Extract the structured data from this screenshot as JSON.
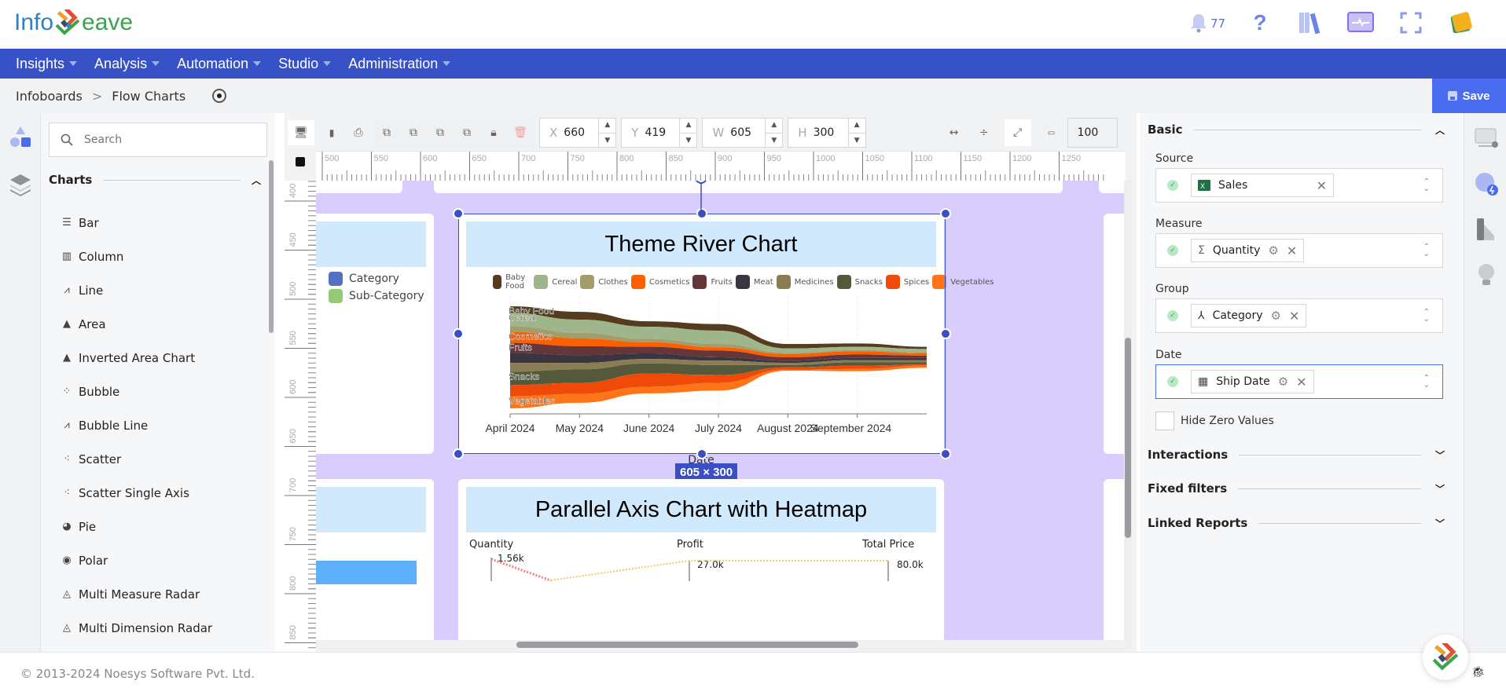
{
  "app": {
    "logo_left": "Info",
    "logo_right": "eave",
    "notification_count": "77"
  },
  "nav": {
    "items": [
      {
        "label": "Insights"
      },
      {
        "label": "Analysis"
      },
      {
        "label": "Automation"
      },
      {
        "label": "Studio"
      },
      {
        "label": "Administration"
      }
    ]
  },
  "breadcrumb": {
    "items": [
      "Infoboards",
      "Flow Charts"
    ],
    "separator": ">"
  },
  "save_label": "Save",
  "left_panel": {
    "search_placeholder": "Search",
    "section_title": "Charts",
    "items": [
      {
        "label": "Bar",
        "icon": "bar-chart-icon",
        "glyph": "☰"
      },
      {
        "label": "Column",
        "icon": "column-chart-icon",
        "glyph": "▥"
      },
      {
        "label": "Line",
        "icon": "line-chart-icon",
        "glyph": "⩘"
      },
      {
        "label": "Area",
        "icon": "area-chart-icon",
        "glyph": "▲"
      },
      {
        "label": "Inverted Area Chart",
        "icon": "inverted-area-chart-icon",
        "glyph": "▲"
      },
      {
        "label": "Bubble",
        "icon": "bubble-chart-icon",
        "glyph": "⁘"
      },
      {
        "label": "Bubble Line",
        "icon": "bubble-line-chart-icon",
        "glyph": "⩘"
      },
      {
        "label": "Scatter",
        "icon": "scatter-chart-icon",
        "glyph": "⁖"
      },
      {
        "label": "Scatter Single Axis",
        "icon": "scatter-single-axis-icon",
        "glyph": "⁖"
      },
      {
        "label": "Pie",
        "icon": "pie-chart-icon",
        "glyph": "◕"
      },
      {
        "label": "Polar",
        "icon": "polar-chart-icon",
        "glyph": "◉"
      },
      {
        "label": "Multi Measure Radar",
        "icon": "radar-chart-icon",
        "glyph": "◬"
      },
      {
        "label": "Multi Dimension Radar",
        "icon": "radar-chart-icon",
        "glyph": "◬"
      }
    ]
  },
  "toolbar": {
    "x_label": "X",
    "x_value": "660",
    "y_label": "Y",
    "y_value": "419",
    "w_label": "W",
    "w_value": "605",
    "h_label": "H",
    "h_value": "300",
    "zoom_value": "100"
  },
  "rulers": {
    "h_ticks": [
      "500",
      "550",
      "600",
      "650",
      "700",
      "750",
      "800",
      "850",
      "900",
      "950",
      "1000",
      "1050",
      "1100",
      "1150",
      "1200",
      "1250"
    ],
    "v_ticks": [
      "400",
      "450",
      "500",
      "550",
      "600",
      "650",
      "700",
      "750",
      "800",
      "850"
    ]
  },
  "canvas": {
    "left_card_legend": [
      {
        "label": "Category",
        "color": "#5470c6"
      },
      {
        "label": "Sub-Category",
        "color": "#91cc75"
      }
    ],
    "selection_size": "605 × 300",
    "bottom_card_title": "Parallel Axis Chart with Heatmap",
    "parallel_axes": [
      {
        "name": "Quantity",
        "max_label": "1.56k"
      },
      {
        "name": "Profit",
        "max_label": "27.0k"
      },
      {
        "name": "Total Price",
        "max_label": "80.0k"
      }
    ]
  },
  "chart_data": {
    "type": "area",
    "subtype": "theme-river",
    "title": "Theme River Chart",
    "xlabel": "Date",
    "ylabel": "",
    "x_ticks": [
      "April 2024",
      "May 2024",
      "June 2024",
      "July 2024",
      "August 2024",
      "September 2024"
    ],
    "x": [
      "2024-04",
      "2024-05",
      "2024-06",
      "2024-07",
      "2024-08",
      "2024-09",
      "2024-10"
    ],
    "legend_position": "top",
    "series_labels_shown": [
      "Baby Food",
      "Cereal",
      "Cosmetics",
      "Fruits",
      "Snacks",
      "Vegetables"
    ],
    "series": [
      {
        "name": "Baby Food",
        "color": "#553c1e",
        "values": [
          6,
          7,
          5,
          6,
          4,
          3,
          2
        ]
      },
      {
        "name": "Cereal",
        "color": "#9fb58c",
        "values": [
          12,
          12,
          11,
          12,
          4,
          3,
          3
        ]
      },
      {
        "name": "Clothes",
        "color": "#a29d6a",
        "values": [
          5,
          5,
          3,
          3,
          1,
          1,
          1
        ]
      },
      {
        "name": "Cosmetics",
        "color": "#fd5f00",
        "values": [
          10,
          7,
          4,
          3,
          3,
          3,
          2
        ]
      },
      {
        "name": "Fruits",
        "color": "#663538",
        "values": [
          9,
          8,
          6,
          6,
          3,
          3,
          2
        ]
      },
      {
        "name": "Meat",
        "color": "#3b3540",
        "values": [
          9,
          7,
          5,
          3,
          2,
          2,
          2
        ]
      },
      {
        "name": "Medicines",
        "color": "#8b7d53",
        "values": [
          8,
          6,
          4,
          4,
          2,
          2,
          2
        ]
      },
      {
        "name": "Snacks",
        "color": "#53593a",
        "values": [
          12,
          12,
          9,
          9,
          2,
          3,
          2
        ]
      },
      {
        "name": "Spices",
        "color": "#ef4a08",
        "values": [
          10,
          10,
          12,
          7,
          2,
          3,
          1
        ]
      },
      {
        "name": "Vegetables",
        "color": "#fd7419",
        "values": [
          11,
          8,
          6,
          7,
          1,
          2,
          2
        ]
      }
    ]
  },
  "right_panel": {
    "sections": {
      "basic": "Basic",
      "interactions": "Interactions",
      "fixed_filters": "Fixed filters",
      "linked_reports": "Linked Reports"
    },
    "fields": {
      "source": {
        "label": "Source",
        "value": "Sales"
      },
      "measure": {
        "label": "Measure",
        "value": "Quantity"
      },
      "group": {
        "label": "Group",
        "value": "Category"
      },
      "date": {
        "label": "Date",
        "value": "Ship Date"
      }
    },
    "hide_zero_label": "Hide Zero Values",
    "hide_zero_checked": false
  },
  "footer": {
    "copyright": "© 2013-2024 Noesys Software Pvt. Ltd."
  }
}
